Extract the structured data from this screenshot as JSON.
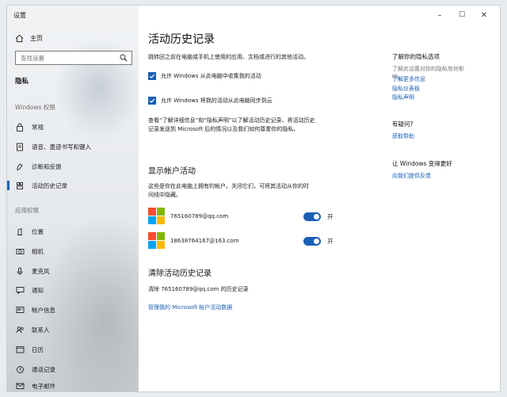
{
  "window": {
    "title": "设置",
    "minimize": "–",
    "maximize": "☐",
    "close": "✕"
  },
  "sidebar": {
    "home": "主页",
    "search_placeholder": "查找设置",
    "section": "隐私",
    "windows_group": "Windows 权限",
    "windows_items": [
      {
        "label": "常规",
        "icon": "lock-icon"
      },
      {
        "label": "语音、墨迹书写和键入",
        "icon": "document-icon"
      },
      {
        "label": "诊断和反馈",
        "icon": "feedback-icon"
      },
      {
        "label": "活动历史记录",
        "icon": "timeline-icon"
      }
    ],
    "app_group": "应用权限",
    "app_items": [
      {
        "label": "位置",
        "icon": "location-icon"
      },
      {
        "label": "相机",
        "icon": "camera-icon"
      },
      {
        "label": "麦克风",
        "icon": "microphone-icon"
      },
      {
        "label": "通知",
        "icon": "notification-icon"
      },
      {
        "label": "帐户信息",
        "icon": "account-icon"
      },
      {
        "label": "联系人",
        "icon": "contacts-icon"
      },
      {
        "label": "日历",
        "icon": "calendar-icon"
      },
      {
        "label": "通话记录",
        "icon": "call-history-icon"
      },
      {
        "label": "电子邮件",
        "icon": "email-icon"
      }
    ]
  },
  "main": {
    "title": "活动历史记录",
    "intro": "跳转回之前在电脑或手机上使用的应用、文档或进行的其他活动。",
    "checkbox1": "允许 Windows 从此电脑中收集我的活动",
    "checkbox2": "允许 Windows 将我的活动从此电脑同步到云",
    "info_line1": "查看“了解详细信息”和“隐私声明”以了解活动历史记录、将活动历史",
    "info_line2": "记录发送到 Microsoft 后的情况以及我们如何尊重你的隐私。",
    "accounts_heading": "显示帐户活动",
    "accounts_desc1": "这些是你在此电脑上拥有的帐户。关闭它们，可将其活动从你的时",
    "accounts_desc2": "间线中隐藏。",
    "accounts": [
      {
        "email": "765160789@qq.com",
        "state": "开"
      },
      {
        "email": "18638764167@163.com",
        "state": "开"
      }
    ],
    "clear_heading": "清除活动历史记录",
    "clear_text": "清除 765160789@qq.com 的历史记录",
    "manage_link": "管理我的 Microsoft 帐户活动数据"
  },
  "right": {
    "privacy_heading": "了解你的隐私选项",
    "privacy_desc1": "了解此设置对你的隐私有何影",
    "privacy_desc2": "响。",
    "link_learn": "了解更多信息",
    "link_dashboard": "隐私仪表板",
    "link_statement": "隐私声明",
    "question_heading": "有疑问?",
    "link_help": "获取帮助",
    "improve_heading": "让 Windows 变得更好",
    "link_feedback": "向我们提供反馈"
  },
  "colors": {
    "accent": "#1a5fb4",
    "ms_red": "#f25022",
    "ms_green": "#7fba00",
    "ms_blue": "#00a4ef",
    "ms_yellow": "#ffb900"
  }
}
